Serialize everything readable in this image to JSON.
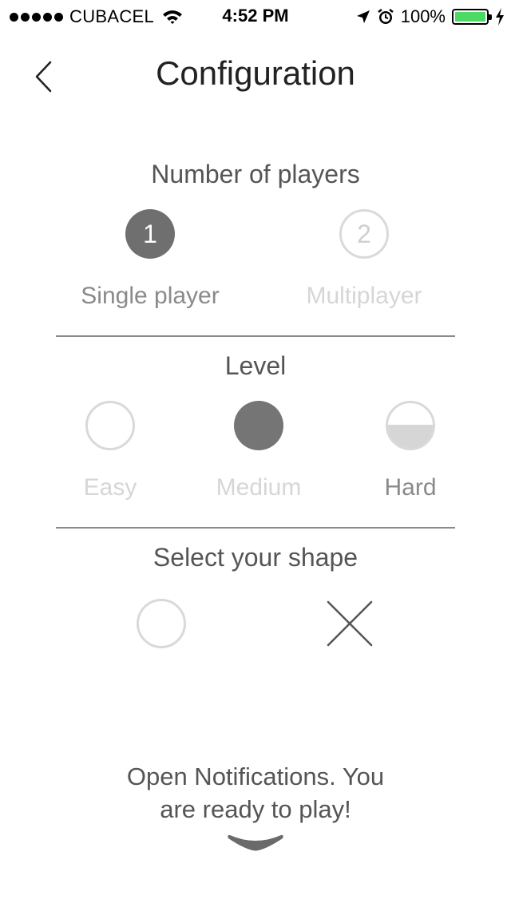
{
  "status_bar": {
    "carrier": "CUBACEL",
    "time": "4:52 PM",
    "battery_percent": "100%",
    "battery_level": 1.0,
    "battery_color": "#4cd964",
    "icons": [
      "signal-dots-icon",
      "wifi-icon",
      "location-arrow-icon",
      "alarm-icon",
      "battery-icon",
      "charging-bolt-icon"
    ]
  },
  "header": {
    "title": "Configuration",
    "back_icon": "chevron-left-icon"
  },
  "players": {
    "title": "Number of players",
    "options": [
      {
        "number": "1",
        "label": "Single player",
        "selected": true
      },
      {
        "number": "2",
        "label": "Multiplayer",
        "selected": false
      }
    ]
  },
  "level": {
    "title": "Level",
    "options": [
      {
        "label": "Easy",
        "selected": false
      },
      {
        "label": "Medium",
        "selected": false
      },
      {
        "label": "Hard",
        "selected": true
      }
    ]
  },
  "shape": {
    "title": "Select your shape",
    "options": [
      "circle-shape-icon",
      "cross-shape-icon"
    ]
  },
  "footer": {
    "line1": "Open Notifications. You",
    "line2": "are ready to play!",
    "icon": "chevron-down-icon"
  }
}
